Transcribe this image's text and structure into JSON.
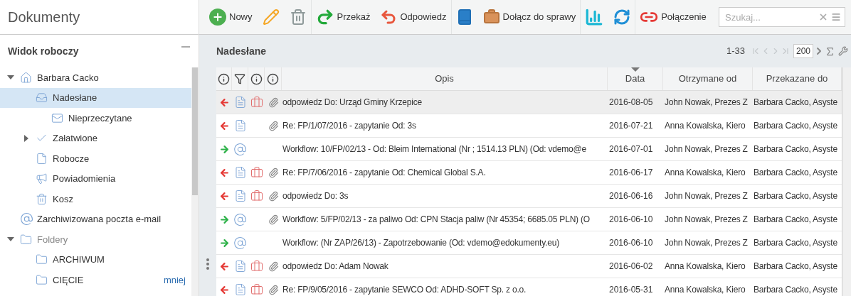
{
  "app_title": "Dokumenty",
  "toolbar": {
    "groups": [
      [
        {
          "kind": "new",
          "label": "Nowy"
        },
        {
          "kind": "edit"
        },
        {
          "kind": "delete"
        }
      ],
      [
        {
          "kind": "forward",
          "label": "Przekaż"
        },
        {
          "kind": "reply",
          "label": "Odpowiedz"
        }
      ],
      [
        {
          "kind": "book"
        },
        {
          "kind": "case",
          "label": "Dołącz do sprawy"
        }
      ],
      [
        {
          "kind": "chart"
        },
        {
          "kind": "refresh"
        }
      ],
      [
        {
          "kind": "connect",
          "label": "Połączenie"
        }
      ]
    ],
    "search": {
      "placeholder": "Szukaj..."
    }
  },
  "sidebar": {
    "title": "Widok roboczy",
    "tree": [
      {
        "kind": "home",
        "label": "Barbara Cacko",
        "expanded": true,
        "selected": false,
        "children": [
          {
            "kind": "inbox",
            "label": "Nadesłane",
            "selected": true,
            "children": [
              {
                "kind": "mail",
                "label": "Nieprzeczytane",
                "selected": false
              }
            ]
          },
          {
            "kind": "done",
            "label": "Załatwione",
            "expanded": false,
            "selected": false
          },
          {
            "kind": "draft",
            "label": "Robocze",
            "selected": false
          },
          {
            "kind": "notice",
            "label": "Powiadomienia",
            "selected": false
          },
          {
            "kind": "trash",
            "label": "Kosz",
            "selected": false
          }
        ]
      },
      {
        "kind": "email",
        "label": "Zarchiwizowana poczta e-mail",
        "selected": false
      },
      {
        "kind": "folder",
        "label": "Foldery",
        "expanded": true,
        "selected": false,
        "children": [
          {
            "kind": "folder",
            "label": "ARCHIWUM",
            "selected": false
          },
          {
            "kind": "folder",
            "label": "CIĘCIE",
            "badge": "mniej",
            "selected": false
          }
        ]
      }
    ]
  },
  "panel": {
    "title": "Nadesłane",
    "range": "1-33",
    "page_size": "200"
  },
  "table": {
    "columns": [
      "Opis",
      "Data",
      "Otrzymane od",
      "Przekazane do"
    ],
    "rows": [
      {
        "incoming": false,
        "kind": "document",
        "case": true,
        "attachment": true,
        "selected": true,
        "opis": "odpowiedz Do: Urząd Gminy Krzepice",
        "data": "2016-08-05",
        "from": "John Nowak, Prezes Z",
        "to": "Barbara Cacko, Asyste"
      },
      {
        "incoming": false,
        "kind": "document",
        "case": false,
        "attachment": true,
        "selected": false,
        "opis": "Re: FP/1/07/2016 - zapytanie Od: 3s",
        "data": "2016-07-21",
        "from": "Anna Kowalska, Kiero",
        "to": "Barbara Cacko, Asyste"
      },
      {
        "incoming": true,
        "kind": "email",
        "case": false,
        "attachment": false,
        "selected": false,
        "opis": "Workflow: 10/FP/02/13 - Od: Bleim International (Nr ; 1514.13 PLN) (Od: vdemo@e",
        "data": "2016-07-01",
        "from": "John Nowak, Prezes Z",
        "to": "Barbara Cacko, Asyste"
      },
      {
        "incoming": false,
        "kind": "document",
        "case": true,
        "attachment": true,
        "selected": false,
        "opis": "Re: FP/7/06/2016 - zapytanie Od: Chemical Global S.A.",
        "data": "2016-06-17",
        "from": "Anna Kowalska, Kiero",
        "to": "Barbara Cacko, Asyste"
      },
      {
        "incoming": false,
        "kind": "document",
        "case": true,
        "attachment": true,
        "selected": false,
        "opis": "odpowiedz Do: 3s",
        "data": "2016-06-16",
        "from": "John Nowak, Prezes Z",
        "to": "Barbara Cacko, Asyste"
      },
      {
        "incoming": true,
        "kind": "email",
        "case": false,
        "attachment": true,
        "selected": false,
        "opis": "Workflow: 5/FP/02/13 - za paliwo Od: CPN Stacja paliw (Nr 45354; 6685.05 PLN) (O",
        "data": "2016-06-10",
        "from": "John Nowak, Prezes Z",
        "to": "Barbara Cacko, Asyste"
      },
      {
        "incoming": true,
        "kind": "email",
        "case": false,
        "attachment": false,
        "selected": false,
        "opis": "Workflow: (Nr ZAP/26/13) - Zapotrzebowanie (Od: vdemo@edokumenty.eu)",
        "data": "2016-06-10",
        "from": "John Nowak, Prezes Z",
        "to": "Barbara Cacko, Asyste"
      },
      {
        "incoming": false,
        "kind": "document",
        "case": true,
        "attachment": true,
        "selected": false,
        "opis": "odpowiedz Do: Adam Nowak",
        "data": "2016-06-02",
        "from": "Anna Kowalska, Kiero",
        "to": "Barbara Cacko, Asyste"
      },
      {
        "incoming": false,
        "kind": "document",
        "case": true,
        "attachment": true,
        "selected": false,
        "opis": "Re: FP/9/05/2016 - zapytanie SEWCO Od: ADHD-SOFT Sp. z o.o.",
        "data": "2016-05-31",
        "from": "Anna Kowalska, Kiero",
        "to": "Barbara Cacko, Asyste"
      }
    ]
  }
}
